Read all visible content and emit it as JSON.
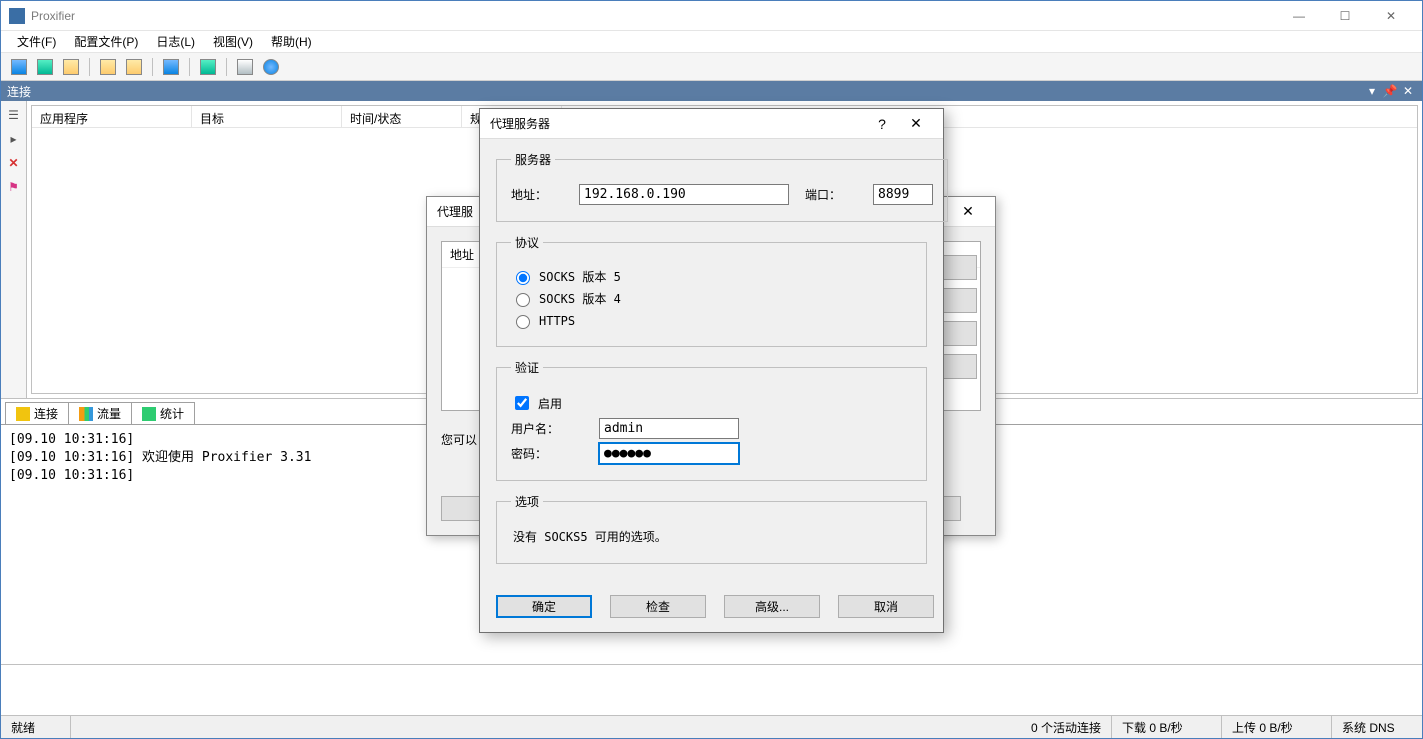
{
  "window": {
    "title": "Proxifier"
  },
  "menu": {
    "file": "文件(F)",
    "profile": "配置文件(P)",
    "log": "日志(L)",
    "view": "视图(V)",
    "help": "帮助(H)"
  },
  "dock": {
    "title": "连接"
  },
  "columns": {
    "app": "应用程序",
    "target": "目标",
    "time_status": "时间/状态",
    "rules": "规"
  },
  "tabs": {
    "connections": "连接",
    "traffic": "流量",
    "stats": "统计"
  },
  "log": {
    "line1": "[09.10 10:31:16]",
    "line2": "[09.10 10:31:16]     欢迎使用 Proxifier 3.31",
    "line3": "[09.10 10:31:16]"
  },
  "status": {
    "ready": "就绪",
    "active_conn": "0 个活动连接",
    "download": "下载 0 B/秒",
    "upload": "上传 0 B/秒",
    "sysdns": "系统 DNS"
  },
  "bg_dialog": {
    "title": "代理服",
    "list_header": "地址",
    "hint": "您可以",
    "close_x": "✕"
  },
  "dialog": {
    "title": "代理服务器",
    "help": "?",
    "close": "✕",
    "server_group": "服务器",
    "address_label": "地址：",
    "address_value": "192.168.0.190",
    "port_label": "端口：",
    "port_value": "8899",
    "protocol_group": "协议",
    "proto_socks5": "SOCKS 版本 5",
    "proto_socks4": "SOCKS 版本 4",
    "proto_https": "HTTPS",
    "auth_group": "验证",
    "auth_enable": "启用",
    "username_label": "用户名：",
    "username_value": "admin",
    "password_label": "密码：",
    "password_value": "●●●●●●",
    "options_group": "选项",
    "options_text": "没有 SOCKS5 可用的选项。",
    "btn_ok": "确定",
    "btn_check": "检查",
    "btn_advanced": "高级...",
    "btn_cancel": "取消"
  }
}
